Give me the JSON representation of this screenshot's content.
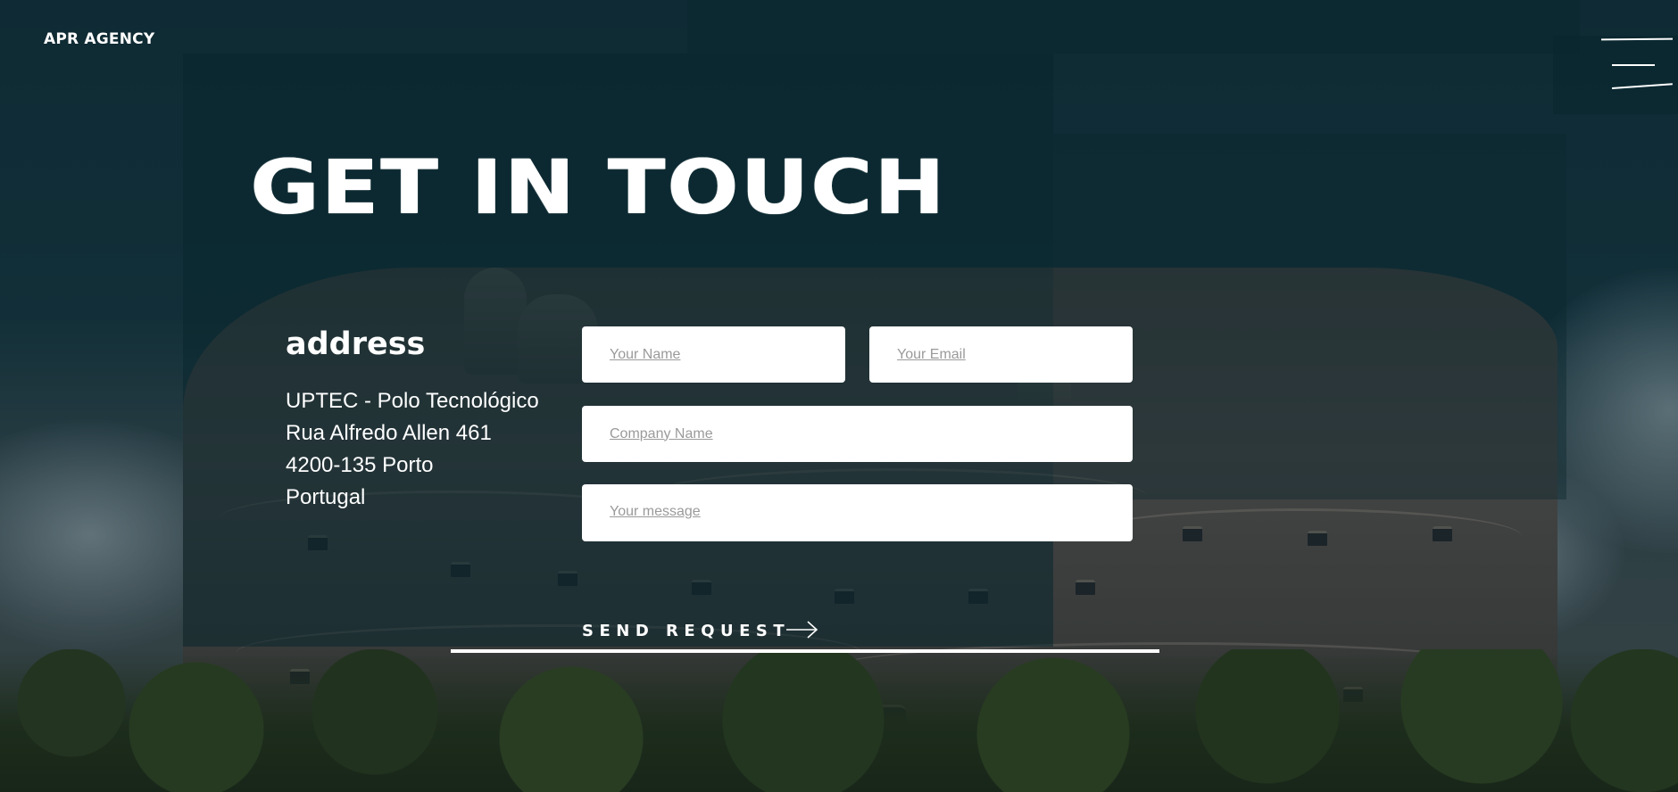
{
  "header": {
    "logo": "APR AGENCY",
    "menu_icon": "menu-icon"
  },
  "main": {
    "title": "GET IN TOUCH",
    "address": {
      "label": "address",
      "lines": [
        "UPTEC - Polo Tecnológico",
        "Rua Alfredo Allen 461",
        "4200-135 Porto",
        "Portugal"
      ]
    },
    "form": {
      "name_placeholder": "Your Name",
      "email_placeholder": "Your Email",
      "company_placeholder": "Company Name",
      "message_placeholder": "Your message",
      "submit_label": "SEND REQUEST",
      "submit_icon": "arrow-right-icon"
    }
  },
  "colors": {
    "background": "#0f2a33",
    "text": "#ffffff",
    "field_background": "#ffffff",
    "placeholder": "#9a9a9a"
  }
}
